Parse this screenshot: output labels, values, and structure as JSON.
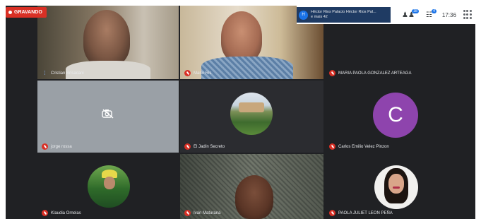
{
  "recording": {
    "label": "GRAVANDO"
  },
  "header": {
    "presenter_text": "Héctor Rios Palacio Héctor Rios Pal...",
    "presenter_more": "e mais 42",
    "presenter_initial": "H",
    "participants_count": "38",
    "chat_badge": "4",
    "time": "17:36"
  },
  "tiles": [
    {
      "name": "Cristian Brisacani",
      "muted": false
    },
    {
      "name": "Mario Ris",
      "muted": true
    },
    {
      "name": "MARIA PAOLA GONZALEZ ARTEAGA",
      "muted": true
    },
    {
      "name": "jorge rossa",
      "muted": true
    },
    {
      "name": "El Jadín Secreto",
      "muted": true
    },
    {
      "name": "Carlos Emilio Velez Pinzon",
      "muted": true,
      "avatar_letter": "C"
    },
    {
      "name": "Klaudia Ornelas",
      "muted": true
    },
    {
      "name": "Iván Maturana",
      "muted": true
    },
    {
      "name": "PAOLA JULIET LEON PEÑA",
      "muted": true
    }
  ],
  "colors": {
    "accent": "#1a73e8",
    "recording": "#d93025",
    "avatar_purple": "#8e44ad"
  },
  "icons": [
    "camera-off-icon",
    "people-icon",
    "chat-icon",
    "apps-icon",
    "mic-off-icon",
    "mic-on-icon"
  ]
}
